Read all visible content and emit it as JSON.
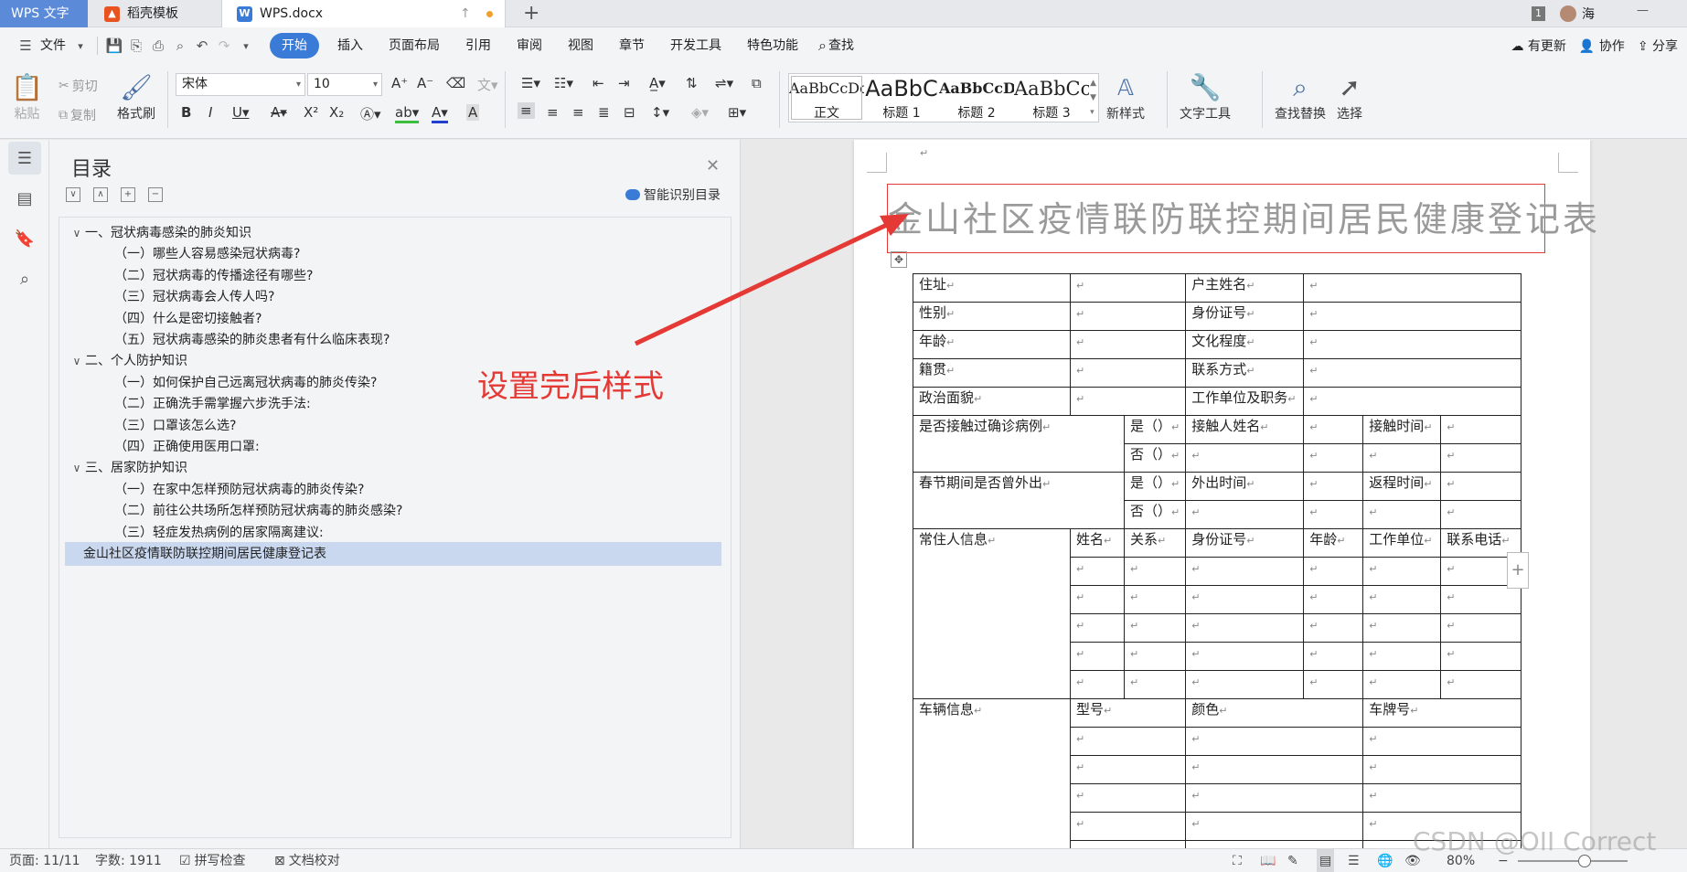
{
  "titlebar": {
    "app_tab": "WPS 文字",
    "tabs": [
      {
        "label": "稻壳模板",
        "logo_color": "#e8531f"
      },
      {
        "label": "WPS.docx",
        "logo_color": "#3a7bd8"
      }
    ],
    "user_badge": "1",
    "user_name": "海"
  },
  "menubar": {
    "file": "文件",
    "items": [
      "开始",
      "插入",
      "页面布局",
      "引用",
      "审阅",
      "视图",
      "章节",
      "开发工具",
      "特色功能",
      "查找"
    ],
    "active": "开始",
    "right": [
      "有更新",
      "协作",
      "分享"
    ]
  },
  "ribbon": {
    "paste": "粘贴",
    "cut": "剪切",
    "copy": "复制",
    "format_painter": "格式刷",
    "font_name": "宋体",
    "font_size": "10",
    "styles": [
      {
        "preview": "AaBbCcDd",
        "label": "正文"
      },
      {
        "preview": "AaBbC",
        "label": "标题 1"
      },
      {
        "preview": "AaBbCcDd",
        "label": "标题 2"
      },
      {
        "preview": "AaBbCc",
        "label": "标题 3"
      }
    ],
    "new_style": "新样式",
    "text_tools": "文字工具",
    "find_replace": "查找替换",
    "select": "选择"
  },
  "toc": {
    "title": "目录",
    "smart_label": "智能识别目录",
    "items": [
      {
        "text": "一、冠状病毒感染的肺炎知识",
        "level": 1
      },
      {
        "text": "（一）哪些人容易感染冠状病毒?",
        "level": 2
      },
      {
        "text": "（二）冠状病毒的传播途径有哪些?",
        "level": 2
      },
      {
        "text": "（三）冠状病毒会人传人吗?",
        "level": 2
      },
      {
        "text": "（四）什么是密切接触者?",
        "level": 2
      },
      {
        "text": "（五）冠状病毒感染的肺炎患者有什么临床表现?",
        "level": 2
      },
      {
        "text": "二、个人防护知识",
        "level": 1
      },
      {
        "text": "（一）如何保护自己远离冠状病毒的肺炎传染?",
        "level": 2
      },
      {
        "text": "（二）正确洗手需掌握六步洗手法:",
        "level": 2
      },
      {
        "text": "（三）口罩该怎么选?",
        "level": 2
      },
      {
        "text": "（四）正确使用医用口罩:",
        "level": 2
      },
      {
        "text": "三、居家防护知识",
        "level": 1
      },
      {
        "text": "（一）在家中怎样预防冠状病毒的肺炎传染?",
        "level": 2
      },
      {
        "text": "（二）前往公共场所怎样预防冠状病毒的肺炎感染?",
        "level": 2
      },
      {
        "text": "（三）轻症发热病例的居家隔离建议:",
        "level": 2
      },
      {
        "text": "金山社区疫情联防联控期间居民健康登记表",
        "level": 0,
        "selected": true
      }
    ]
  },
  "document": {
    "title": "金山社区疫情联防联控期间居民健康登记表",
    "annotation": "设置完后样式",
    "cells": {
      "address": "住址",
      "householder": "户主姓名",
      "gender": "性别",
      "id_no": "身份证号",
      "age": "年龄",
      "education": "文化程度",
      "origin": "籍贯",
      "contact": "联系方式",
      "politics": "政治面貌",
      "workplace": "工作单位及职务",
      "contact_case": "是否接触过确诊病例",
      "yes": "是（）",
      "no": "否（）",
      "contact_name": "接触人姓名",
      "contact_time": "接触时间",
      "spring_out": "春节期间是否曾外出",
      "out_time": "外出时间",
      "return_time": "返程时间",
      "residents": "常住人信息",
      "name": "姓名",
      "relation": "关系",
      "res_age": "年龄",
      "res_work": "工作单位",
      "res_phone": "联系电话",
      "vehicle": "车辆信息",
      "model": "型号",
      "color": "颜色",
      "plate": "车牌号"
    }
  },
  "statusbar": {
    "page": "页面: 11/11",
    "words": "字数: 1911",
    "spell": "拼写检查",
    "proof": "文档校对",
    "zoom": "80%"
  },
  "watermark": "CSDN @OII Correct"
}
